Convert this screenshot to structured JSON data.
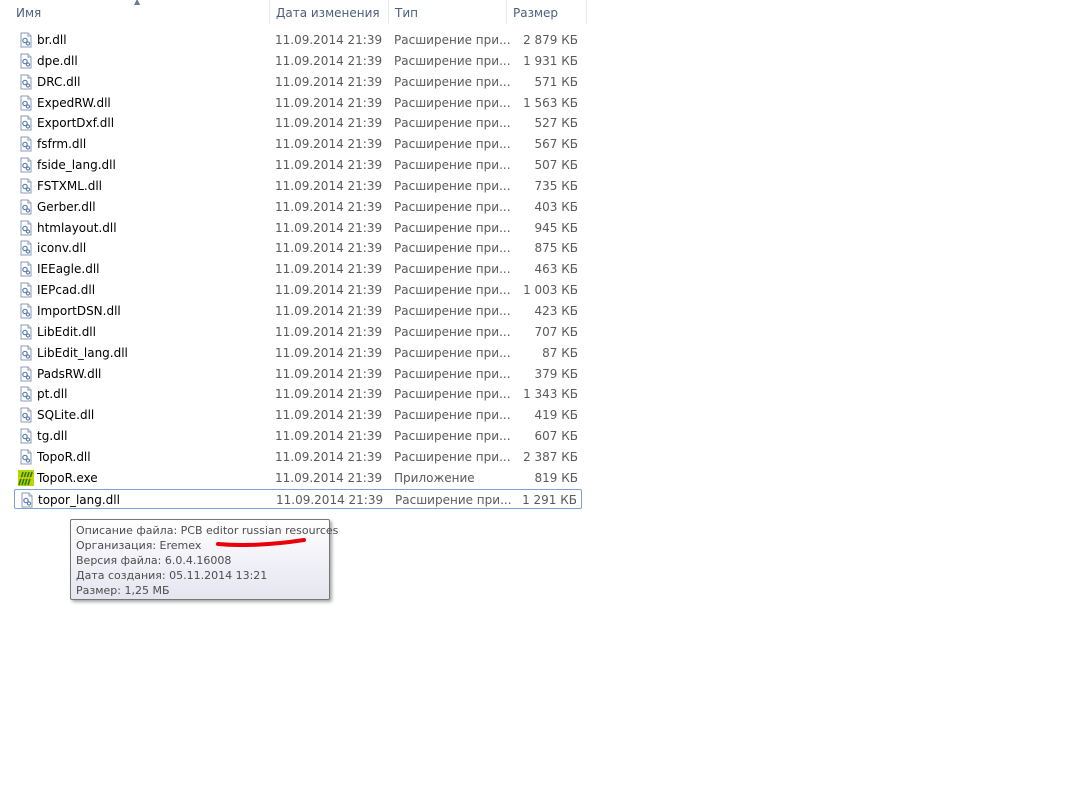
{
  "columns": {
    "name": "Имя",
    "date": "Дата изменения",
    "type": "Тип",
    "size": "Размер"
  },
  "files": [
    {
      "name": "br.dll",
      "date": "11.09.2014 21:39",
      "type": "Расширение при...",
      "size": "2 879 КБ",
      "icon": "dll-file-icon"
    },
    {
      "name": "dpe.dll",
      "date": "11.09.2014 21:39",
      "type": "Расширение при...",
      "size": "1 931 КБ",
      "icon": "dll-file-icon"
    },
    {
      "name": "DRC.dll",
      "date": "11.09.2014 21:39",
      "type": "Расширение при...",
      "size": "571 КБ",
      "icon": "dll-file-icon"
    },
    {
      "name": "ExpedRW.dll",
      "date": "11.09.2014 21:39",
      "type": "Расширение при...",
      "size": "1 563 КБ",
      "icon": "dll-file-icon"
    },
    {
      "name": "ExportDxf.dll",
      "date": "11.09.2014 21:39",
      "type": "Расширение при...",
      "size": "527 КБ",
      "icon": "dll-file-icon"
    },
    {
      "name": "fsfrm.dll",
      "date": "11.09.2014 21:39",
      "type": "Расширение при...",
      "size": "567 КБ",
      "icon": "dll-file-icon"
    },
    {
      "name": "fside_lang.dll",
      "date": "11.09.2014 21:39",
      "type": "Расширение при...",
      "size": "507 КБ",
      "icon": "dll-file-icon"
    },
    {
      "name": "FSTXML.dll",
      "date": "11.09.2014 21:39",
      "type": "Расширение при...",
      "size": "735 КБ",
      "icon": "dll-file-icon"
    },
    {
      "name": "Gerber.dll",
      "date": "11.09.2014 21:39",
      "type": "Расширение при...",
      "size": "403 КБ",
      "icon": "dll-file-icon"
    },
    {
      "name": "htmlayout.dll",
      "date": "11.09.2014 21:39",
      "type": "Расширение при...",
      "size": "945 КБ",
      "icon": "dll-file-icon"
    },
    {
      "name": "iconv.dll",
      "date": "11.09.2014 21:39",
      "type": "Расширение при...",
      "size": "875 КБ",
      "icon": "dll-file-icon"
    },
    {
      "name": "IEEagle.dll",
      "date": "11.09.2014 21:39",
      "type": "Расширение при...",
      "size": "463 КБ",
      "icon": "dll-file-icon"
    },
    {
      "name": "IEPcad.dll",
      "date": "11.09.2014 21:39",
      "type": "Расширение при...",
      "size": "1 003 КБ",
      "icon": "dll-file-icon"
    },
    {
      "name": "ImportDSN.dll",
      "date": "11.09.2014 21:39",
      "type": "Расширение при...",
      "size": "423 КБ",
      "icon": "dll-file-icon"
    },
    {
      "name": "LibEdit.dll",
      "date": "11.09.2014 21:39",
      "type": "Расширение при...",
      "size": "707 КБ",
      "icon": "dll-file-icon"
    },
    {
      "name": "LibEdit_lang.dll",
      "date": "11.09.2014 21:39",
      "type": "Расширение при...",
      "size": "87 КБ",
      "icon": "dll-file-icon"
    },
    {
      "name": "PadsRW.dll",
      "date": "11.09.2014 21:39",
      "type": "Расширение при...",
      "size": "379 КБ",
      "icon": "dll-file-icon"
    },
    {
      "name": "pt.dll",
      "date": "11.09.2014 21:39",
      "type": "Расширение при...",
      "size": "1 343 КБ",
      "icon": "dll-file-icon"
    },
    {
      "name": "SQLite.dll",
      "date": "11.09.2014 21:39",
      "type": "Расширение при...",
      "size": "419 КБ",
      "icon": "dll-file-icon"
    },
    {
      "name": "tg.dll",
      "date": "11.09.2014 21:39",
      "type": "Расширение при...",
      "size": "607 КБ",
      "icon": "dll-file-icon"
    },
    {
      "name": "TopoR.dll",
      "date": "11.09.2014 21:39",
      "type": "Расширение при...",
      "size": "2 387 КБ",
      "icon": "dll-file-icon"
    },
    {
      "name": "TopoR.exe",
      "date": "11.09.2014 21:39",
      "type": "Приложение",
      "size": "819 КБ",
      "icon": "topor-app-icon"
    },
    {
      "name": "topor_lang.dll",
      "date": "11.09.2014 21:39",
      "type": "Расширение при...",
      "size": "1 291 КБ",
      "icon": "dll-file-icon",
      "selected": true
    }
  ],
  "tooltip": {
    "description": "Описание файла: PCB editor russian resources",
    "organization": "Организация: Eremex",
    "version": "Версия файла: 6.0.4.16008",
    "created": "Дата создания: 05.11.2014 13:21",
    "size": "Размер: 1,25 МБ"
  },
  "colors": {
    "header_text": "#4c607a",
    "selection_border": "#7da2ce",
    "annotation_red": "#e8000d"
  }
}
